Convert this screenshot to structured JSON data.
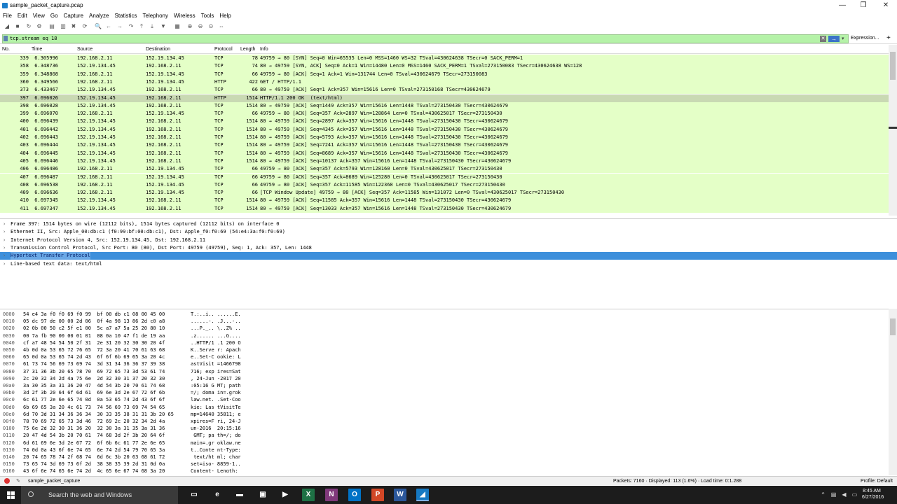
{
  "window": {
    "title": "sample_packet_capture.pcap",
    "controls": {
      "minimize": "—",
      "restore": "❐",
      "close": "✕"
    }
  },
  "menu": [
    "File",
    "Edit",
    "View",
    "Go",
    "Capture",
    "Analyze",
    "Statistics",
    "Telephony",
    "Wireless",
    "Tools",
    "Help"
  ],
  "toolbar_icons": [
    "start-capture-icon",
    "stop-capture-icon",
    "restart-capture-icon",
    "capture-options-icon",
    "open-file-icon",
    "save-file-icon",
    "close-file-icon",
    "reload-file-icon",
    "find-packet-icon",
    "go-back-icon",
    "go-forward-icon",
    "go-to-packet-icon",
    "go-first-icon",
    "go-last-icon",
    "autoscroll-icon",
    "colorize-icon",
    "zoom-in-icon",
    "zoom-out-icon",
    "normal-size-icon",
    "resize-columns-icon"
  ],
  "filter": {
    "value": "tcp.stream eq 18",
    "expression_label": "Expression...",
    "plus": "+",
    "clear": "✕",
    "apply": "→",
    "dropdown": "▾"
  },
  "columns": [
    "No.",
    "Time",
    "Source",
    "Destination",
    "Protocol",
    "Length",
    "Info"
  ],
  "packets": [
    {
      "no": "339",
      "time": "6.305996",
      "src": "192.168.2.11",
      "dst": "152.19.134.45",
      "proto": "TCP",
      "len": "78",
      "info": "49759 → 80 [SYN] Seq=0 Win=65535 Len=0 MSS=1460 WS=32 TSval=430624638 TSecr=0 SACK_PERM=1"
    },
    {
      "no": "358",
      "time": "6.348736",
      "src": "152.19.134.45",
      "dst": "192.168.2.11",
      "proto": "TCP",
      "len": "74",
      "info": "80 → 49759 [SYN, ACK] Seq=0 Ack=1 Win=14480 Len=0 MSS=1460 SACK_PERM=1 TSval=273150083 TSecr=430624638 WS=128"
    },
    {
      "no": "359",
      "time": "6.348808",
      "src": "192.168.2.11",
      "dst": "152.19.134.45",
      "proto": "TCP",
      "len": "66",
      "info": "49759 → 80 [ACK] Seq=1 Ack=1 Win=131744 Len=0 TSval=430624679 TSecr=273150083"
    },
    {
      "no": "360",
      "time": "6.349566",
      "src": "192.168.2.11",
      "dst": "152.19.134.45",
      "proto": "HTTP",
      "len": "422",
      "info": "GET / HTTP/1.1"
    },
    {
      "no": "373",
      "time": "6.433467",
      "src": "152.19.134.45",
      "dst": "192.168.2.11",
      "proto": "TCP",
      "len": "66",
      "info": "80 → 49759 [ACK] Seq=1 Ack=357 Win=15616 Len=0 TSval=273150168 TSecr=430624679"
    },
    {
      "no": "397",
      "time": "6.696026",
      "src": "152.19.134.45",
      "dst": "192.168.2.11",
      "proto": "HTTP",
      "len": "1514",
      "info": "HTTP/1.1 200 OK  (text/html)",
      "selected": true
    },
    {
      "no": "398",
      "time": "6.696028",
      "src": "152.19.134.45",
      "dst": "192.168.2.11",
      "proto": "TCP",
      "len": "1514",
      "info": "80 → 49759 [ACK] Seq=1449 Ack=357 Win=15616 Len=1448 TSval=273150430 TSecr=430624679"
    },
    {
      "no": "399",
      "time": "6.696070",
      "src": "192.168.2.11",
      "dst": "152.19.134.45",
      "proto": "TCP",
      "len": "66",
      "info": "49759 → 80 [ACK] Seq=357 Ack=2897 Win=128864 Len=0 TSval=430625017 TSecr=273150430"
    },
    {
      "no": "400",
      "time": "6.696439",
      "src": "152.19.134.45",
      "dst": "192.168.2.11",
      "proto": "TCP",
      "len": "1514",
      "info": "80 → 49759 [ACK] Seq=2897 Ack=357 Win=15616 Len=1448 TSval=273150430 TSecr=430624679"
    },
    {
      "no": "401",
      "time": "6.696442",
      "src": "152.19.134.45",
      "dst": "192.168.2.11",
      "proto": "TCP",
      "len": "1514",
      "info": "80 → 49759 [ACK] Seq=4345 Ack=357 Win=15616 Len=1448 TSval=273150430 TSecr=430624679"
    },
    {
      "no": "402",
      "time": "6.696443",
      "src": "152.19.134.45",
      "dst": "192.168.2.11",
      "proto": "TCP",
      "len": "1514",
      "info": "80 → 49759 [ACK] Seq=5793 Ack=357 Win=15616 Len=1448 TSval=273150430 TSecr=430624679"
    },
    {
      "no": "403",
      "time": "6.696444",
      "src": "152.19.134.45",
      "dst": "192.168.2.11",
      "proto": "TCP",
      "len": "1514",
      "info": "80 → 49759 [ACK] Seq=7241 Ack=357 Win=15616 Len=1448 TSval=273150430 TSecr=430624679"
    },
    {
      "no": "404",
      "time": "6.696445",
      "src": "152.19.134.45",
      "dst": "192.168.2.11",
      "proto": "TCP",
      "len": "1514",
      "info": "80 → 49759 [ACK] Seq=8689 Ack=357 Win=15616 Len=1448 TSval=273150430 TSecr=430624679"
    },
    {
      "no": "405",
      "time": "6.696446",
      "src": "152.19.134.45",
      "dst": "192.168.2.11",
      "proto": "TCP",
      "len": "1514",
      "info": "80 → 49759 [ACK] Seq=10137 Ack=357 Win=15616 Len=1448 TSval=273150430 TSecr=430624679"
    },
    {
      "no": "406",
      "time": "6.696486",
      "src": "192.168.2.11",
      "dst": "152.19.134.45",
      "proto": "TCP",
      "len": "66",
      "info": "49759 → 80 [ACK] Seq=357 Ack=5793 Win=128160 Len=0 TSval=430625017 TSecr=273150430"
    },
    {
      "no": "407",
      "time": "6.696487",
      "src": "192.168.2.11",
      "dst": "152.19.134.45",
      "proto": "TCP",
      "len": "66",
      "info": "49759 → 80 [ACK] Seq=357 Ack=8689 Win=125280 Len=0 TSval=430625017 TSecr=273150430"
    },
    {
      "no": "408",
      "time": "6.696538",
      "src": "192.168.2.11",
      "dst": "152.19.134.45",
      "proto": "TCP",
      "len": "66",
      "info": "49759 → 80 [ACK] Seq=357 Ack=11585 Win=122368 Len=0 TSval=430625017 TSecr=273150430"
    },
    {
      "no": "409",
      "time": "6.696636",
      "src": "192.168.2.11",
      "dst": "152.19.134.45",
      "proto": "TCP",
      "len": "66",
      "info": "[TCP Window Update] 49759 → 80 [ACK] Seq=357 Ack=11585 Win=131072 Len=0 TSval=430625017 TSecr=273150430"
    },
    {
      "no": "410",
      "time": "6.697345",
      "src": "152.19.134.45",
      "dst": "192.168.2.11",
      "proto": "TCP",
      "len": "1514",
      "info": "80 → 49759 [ACK] Seq=11585 Ack=357 Win=15616 Len=1448 TSval=273150430 TSecr=430624679"
    },
    {
      "no": "411",
      "time": "6.697347",
      "src": "152.19.134.45",
      "dst": "192.168.2.11",
      "proto": "TCP",
      "len": "1514",
      "info": "80 → 49759 [ACK] Seq=13033 Ack=357 Win=15616 Len=1448 TSval=273150430 TSecr=430624679"
    }
  ],
  "details": [
    {
      "text": "Frame 397: 1514 bytes on wire (12112 bits), 1514 bytes captured (12112 bits) on interface 0"
    },
    {
      "text": "Ethernet II, Src: Apple_00:db:c1 (f0:99:bf:00:db:c1), Dst: Apple_f0:f0:69 (54:e4:3a:f0:f0:69)"
    },
    {
      "text": "Internet Protocol Version 4, Src: 152.19.134.45, Dst: 192.168.2.11"
    },
    {
      "text": "Transmission Control Protocol, Src Port: 80 (80), Dst Port: 49759 (49759), Seq: 1, Ack: 357, Len: 1448"
    },
    {
      "text": "Hypertext Transfer Protocol",
      "selected": true
    },
    {
      "text": "Line-based text data: text/html"
    }
  ],
  "bytes": [
    {
      "off": "0000",
      "hex": "54 e4 3a f0 f0 69 f0 99  bf 00 db c1 08 00 45 00",
      "ascii": "T.:..i.. ......E."
    },
    {
      "off": "0010",
      "hex": "05 dc 97 de 00 00 2d 06  0f 4a 98 13 86 2d c0 a8",
      "ascii": "......-. .J...-.."
    },
    {
      "off": "0020",
      "hex": "02 0b 00 50 c2 5f e1 00  5c a7 a7 5a 25 20 80 10",
      "ascii": "...P._.. \\..Z% .."
    },
    {
      "off": "0030",
      "hex": "00 7a fb 90 00 00 01 01  08 0a 10 47 f1 de 19 aa",
      "ascii": ".z...... ...G...."
    },
    {
      "off": "0040",
      "hex": "cf a7 48 54 54 50 2f 31  2e 31 20 32 30 30 20 4f",
      "ascii": "..HTTP/1 .1 200 O"
    },
    {
      "off": "0050",
      "hex": "4b 0d 0a 53 65 72 76 65  72 3a 20 41 70 61 63 68",
      "ascii": "K..Serve r: Apach"
    },
    {
      "off": "0060",
      "hex": "65 0d 0a 53 65 74 2d 43  6f 6f 6b 69 65 3a 20 4c",
      "ascii": "e..Set-C ookie: L"
    },
    {
      "off": "0070",
      "hex": "61 73 74 56 69 73 69 74  3d 31 34 36 36 37 39 38",
      "ascii": "astVisit =1466798"
    },
    {
      "off": "0080",
      "hex": "37 31 36 3b 20 65 78 70  69 72 65 73 3d 53 61 74",
      "ascii": "716; exp ires=Sat"
    },
    {
      "off": "0090",
      "hex": "2c 20 32 34 2d 4a 75 6e  2d 32 30 31 37 20 32 30",
      "ascii": ", 24-Jun -2017 20"
    },
    {
      "off": "00a0",
      "hex": "3a 30 35 3a 31 36 20 47  4d 54 3b 20 70 61 74 68",
      "ascii": ":05:16 G MT; path"
    },
    {
      "off": "00b0",
      "hex": "3d 2f 3b 20 64 6f 6d 61  69 6e 3d 2e 67 72 6f 6b",
      "ascii": "=/; doma in=.grok"
    },
    {
      "off": "00c0",
      "hex": "6c 61 77 2e 6e 65 74 0d  0a 53 65 74 2d 43 6f 6f",
      "ascii": "law.net. .Set-Coo"
    },
    {
      "off": "00d0",
      "hex": "6b 69 65 3a 20 4c 61 73  74 56 69 73 69 74 54 65",
      "ascii": "kie: Las tVisitTe"
    },
    {
      "off": "00e0",
      "hex": "6d 70 3d 31 34 36 36 34  30 33 35 38 31 31 3b 20 65",
      "ascii": "mp=14640 35811; e"
    },
    {
      "off": "00f0",
      "hex": "78 70 69 72 65 73 3d 46  72 69 2c 20 32 34 2d 4a",
      "ascii": "xpires=F ri, 24-J"
    },
    {
      "off": "0100",
      "hex": "75 6e 2d 32 30 31 36 20  32 30 3a 31 35 3a 31 36",
      "ascii": "un-2016  20:15:16"
    },
    {
      "off": "0110",
      "hex": "20 47 4d 54 3b 20 70 61  74 68 3d 2f 3b 20 64 6f",
      "ascii": " GMT; pa th=/; do"
    },
    {
      "off": "0120",
      "hex": "6d 61 69 6e 3d 2e 67 72  6f 6b 6c 61 77 2e 6e 65",
      "ascii": "main=.gr oklaw.ne"
    },
    {
      "off": "0130",
      "hex": "74 0d 0a 43 6f 6e 74 65  6e 74 2d 54 79 70 65 3a",
      "ascii": "t..Conte nt-Type:"
    },
    {
      "off": "0140",
      "hex": "20 74 65 78 74 2f 68 74  6d 6c 3b 20 63 68 61 72",
      "ascii": " text/ht ml; char"
    },
    {
      "off": "0150",
      "hex": "73 65 74 3d 69 73 6f 2d  38 38 35 39 2d 31 0d 0a",
      "ascii": "set=iso- 8859-1.."
    },
    {
      "off": "0160",
      "hex": "43 6f 6e 74 65 6e 74 2d  4c 65 6e 67 74 68 3a 20",
      "ascii": "Content- Length: "
    }
  ],
  "status": {
    "file": "sample_packet_capture",
    "counts": "Packets: 7160 · Displayed: 113 (1.6%) · Load time: 0:1.288",
    "profile": "Profile: Default"
  },
  "taskbar": {
    "search_placeholder": "Search the web and Windows",
    "apps": [
      {
        "icon": "task-view-icon",
        "glyph": "▭",
        "color": "#1c1c1c"
      },
      {
        "icon": "edge-icon",
        "glyph": "e",
        "color": "#1c1c1c"
      },
      {
        "icon": "file-explorer-icon",
        "glyph": "▬",
        "color": "#1c1c1c"
      },
      {
        "icon": "store-icon",
        "glyph": "▣",
        "color": "#1c1c1c"
      },
      {
        "icon": "media-player-icon",
        "glyph": "▶",
        "color": "#1c1c1c"
      },
      {
        "icon": "excel-icon",
        "glyph": "X",
        "color": "#1e7145"
      },
      {
        "icon": "onenote-icon",
        "glyph": "N",
        "color": "#80397b"
      },
      {
        "icon": "outlook-icon",
        "glyph": "O",
        "color": "#0072c6"
      },
      {
        "icon": "powerpoint-icon",
        "glyph": "P",
        "color": "#d24726"
      },
      {
        "icon": "word-icon",
        "glyph": "W",
        "color": "#2b579a"
      },
      {
        "icon": "wireshark-icon",
        "glyph": "◢",
        "color": "#1679c2",
        "active": true
      }
    ],
    "time": "8:45 AM",
    "date": "6/27/2016"
  }
}
